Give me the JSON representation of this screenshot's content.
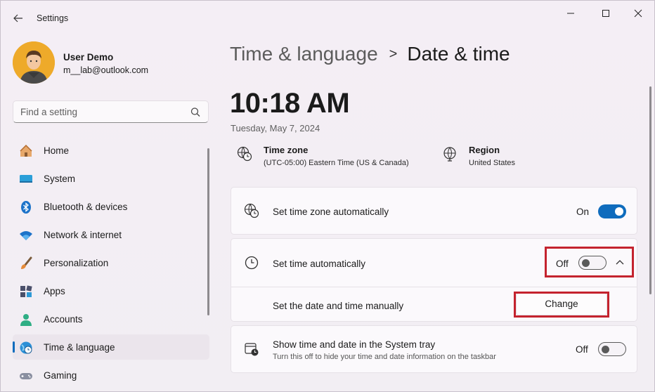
{
  "window": {
    "title": "Settings",
    "controls": [
      "minimize-icon",
      "maximize-icon",
      "close-icon"
    ]
  },
  "user": {
    "name": "User Demo",
    "email": "m__lab@outlook.com"
  },
  "search": {
    "placeholder": "Find a setting"
  },
  "sidebar": {
    "items": [
      {
        "label": "Home",
        "icon": "home-icon"
      },
      {
        "label": "System",
        "icon": "system-icon"
      },
      {
        "label": "Bluetooth & devices",
        "icon": "bluetooth-icon"
      },
      {
        "label": "Network & internet",
        "icon": "wifi-icon"
      },
      {
        "label": "Personalization",
        "icon": "brush-icon"
      },
      {
        "label": "Apps",
        "icon": "apps-icon"
      },
      {
        "label": "Accounts",
        "icon": "person-icon"
      },
      {
        "label": "Time & language",
        "icon": "globe-clock-icon",
        "selected": true
      },
      {
        "label": "Gaming",
        "icon": "gamepad-icon"
      }
    ]
  },
  "breadcrumb": {
    "parent": "Time & language",
    "separator": ">",
    "current": "Date & time"
  },
  "clock": {
    "time": "10:18 AM",
    "date": "Tuesday, May 7, 2024"
  },
  "info": {
    "timezone": {
      "title": "Time zone",
      "value": "(UTC-05:00) Eastern Time (US & Canada)"
    },
    "region": {
      "title": "Region",
      "value": "United States"
    }
  },
  "settings": {
    "tz_auto": {
      "label": "Set time zone automatically",
      "state": "On"
    },
    "time_auto": {
      "label": "Set time automatically",
      "state": "Off"
    },
    "manual": {
      "label": "Set the date and time manually",
      "button": "Change"
    },
    "tray": {
      "label": "Show time and date in the System tray",
      "sub": "Turn this off to hide your time and date information on the taskbar",
      "state": "Off"
    }
  },
  "colors": {
    "accent": "#0f6cbd",
    "highlight": "#c4232e"
  }
}
